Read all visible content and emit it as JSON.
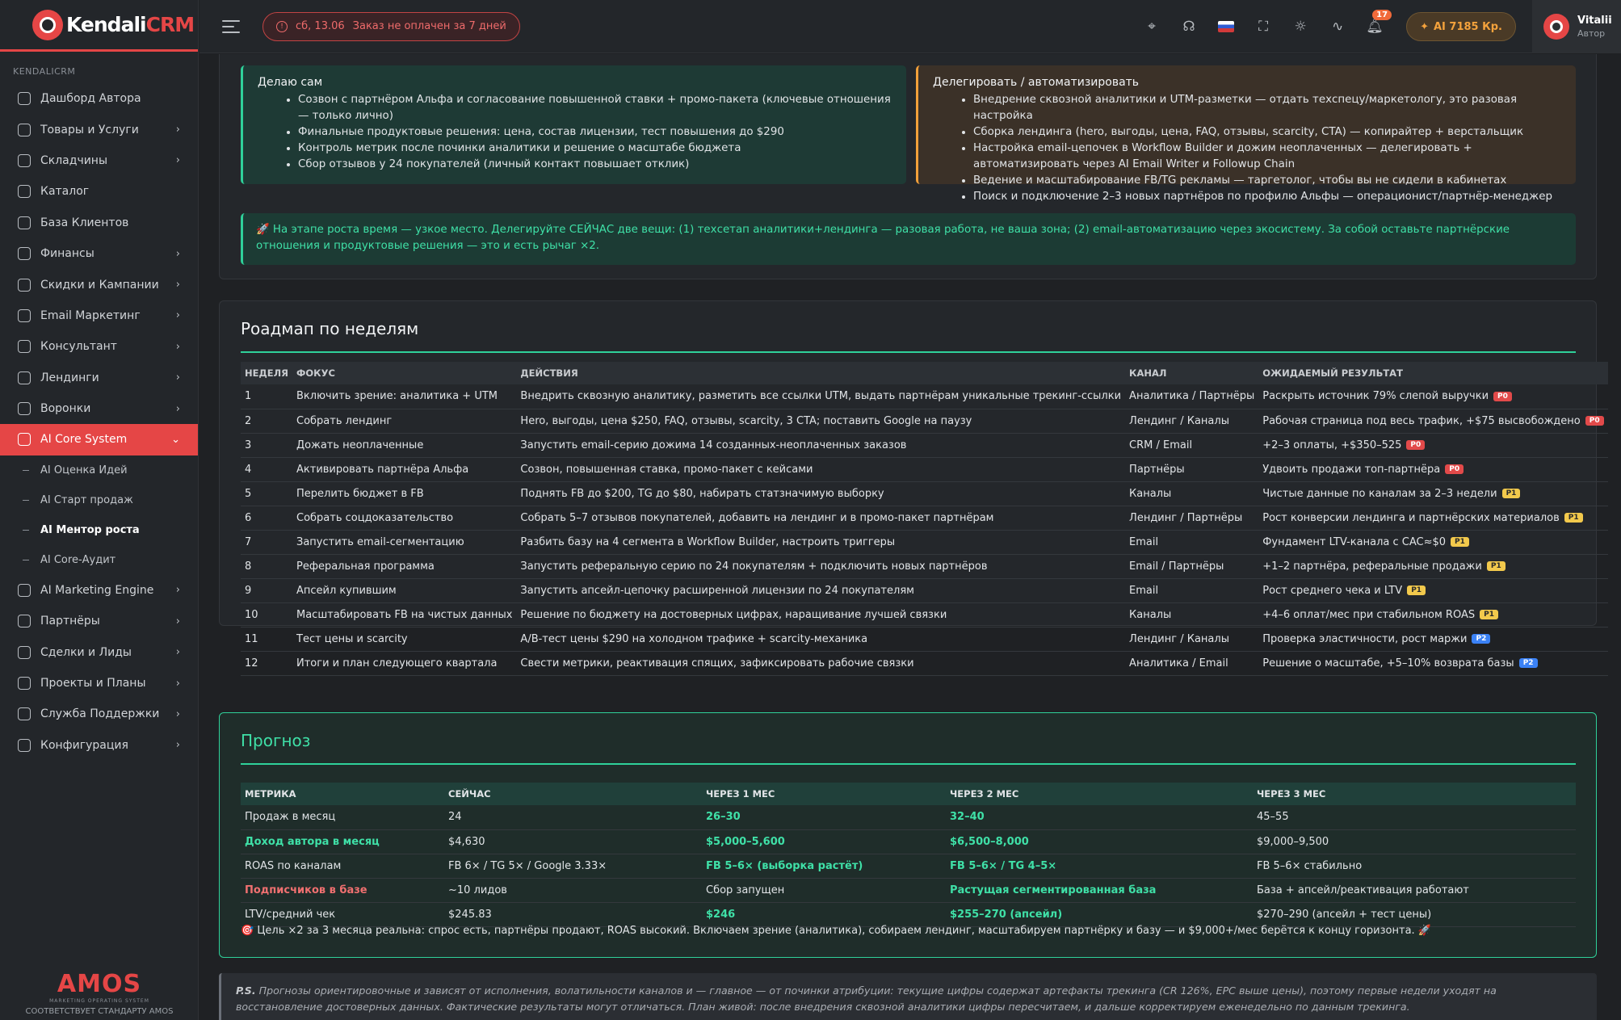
{
  "brand": {
    "name_a": "Kendali",
    "name_b": "CRM"
  },
  "sidebar": {
    "section_label": "KENDALICRM",
    "items": [
      {
        "label": "Дашборд Автора",
        "icon": "home-icon",
        "chevron": false
      },
      {
        "label": "Товары и Услуги",
        "icon": "box-icon",
        "chevron": true
      },
      {
        "label": "Складчины",
        "icon": "people-icon",
        "chevron": true
      },
      {
        "label": "Каталог",
        "icon": "store-icon",
        "chevron": false
      },
      {
        "label": "База Клиентов",
        "icon": "user-icon",
        "chevron": false
      },
      {
        "label": "Финансы",
        "icon": "wallet-icon",
        "chevron": true
      },
      {
        "label": "Скидки и Кампании",
        "icon": "tag-icon",
        "chevron": true
      },
      {
        "label": "Email Маркетинг",
        "icon": "mail-icon",
        "chevron": true
      },
      {
        "label": "Консультант",
        "icon": "headset-icon",
        "chevron": true
      },
      {
        "label": "Лендинги",
        "icon": "layout-icon",
        "chevron": true
      },
      {
        "label": "Воронки",
        "icon": "funnel-icon",
        "chevron": true
      },
      {
        "label": "AI Core System",
        "icon": "sparkle-icon",
        "chevron": true,
        "active": true
      }
    ],
    "sub_items": [
      "AI Оценка Идей",
      "AI Старт продаж",
      "AI Ментор роста",
      "AI Core-Аудит"
    ],
    "items_after": [
      {
        "label": "AI Marketing Engine",
        "icon": "rocket-icon"
      },
      {
        "label": "Партнёры",
        "icon": "partners-icon"
      },
      {
        "label": "Сделки и Лиды",
        "icon": "handshake-icon"
      },
      {
        "label": "Проекты и Планы",
        "icon": "projects-icon"
      },
      {
        "label": "Служба Поддержки",
        "icon": "support-icon"
      },
      {
        "label": "Конфигурация",
        "icon": "gear-icon"
      }
    ],
    "footer_logo": "AMOS",
    "footer_tagline": "MARKETING OPERATING SYSTEM",
    "footer_compliance": "СООТВЕТСТВУЕТ СТАНДАРТУ AMOS"
  },
  "topbar": {
    "alert_date": "сб, 13.06",
    "alert_text": "Заказ не оплачен за 7 дней",
    "notif_count": "17",
    "credits": "AI 7185 Кр.",
    "user_name": "Vitalii",
    "user_role": "Автор"
  },
  "self": {
    "title": "Делаю сам",
    "items": [
      "Созвон с партнёром Альфа и согласование повышенной ставки + промо-пакета (ключевые отношения — только лично)",
      "Финальные продуктовые решения: цена, состав лицензии, тест повышения до $290",
      "Контроль метрик после починки аналитики и решение о масштабе бюджета",
      "Сбор отзывов у 24 покупателей (личный контакт повышает отклик)"
    ]
  },
  "delegate": {
    "title": "Делегировать / автоматизировать",
    "items": [
      "Внедрение сквозной аналитики и UTM-разметки — отдать техспецу/маркетологу, это разовая настройка",
      "Сборка лендинга (hero, выгоды, цена, FAQ, отзывы, scarcity, CTA) — копирайтер + верстальщик",
      "Настройка email-цепочек в Workflow Builder и дожим неоплаченных — делегировать + автоматизировать через AI Email Writer и Followup Chain",
      "Ведение и масштабирование FB/TG рекламы — таргетолог, чтобы вы не сидели в кабинетах",
      "Поиск и подключение 2–3 новых партнёров по профилю Альфы — операционист/партнёр-менеджер"
    ]
  },
  "tip": "🚀 На этапе роста время — узкое место. Делегируйте СЕЙЧАС две вещи: (1) техсетап аналитики+лендинга — разовая работа, не ваша зона; (2) email-автоматизацию через экосистему. За собой оставьте партнёрские отношения и продуктовые решения — это и есть рычаг ×2.",
  "roadmap": {
    "title": "Роадмап по неделям",
    "headers": [
      "НЕДЕЛЯ",
      "ФОКУС",
      "ДЕЙСТВИЯ",
      "КАНАЛ",
      "ОЖИДАЕМЫЙ РЕЗУЛЬТАТ"
    ],
    "rows": [
      [
        "1",
        "Включить зрение: аналитика + UTM",
        "Внедрить сквозную аналитику, разметить все ссылки UTM, выдать партнёрам уникальные трекинг-ссылки",
        "Аналитика / Партнёры",
        "Раскрыть источник 79% слепой выручки",
        "P0"
      ],
      [
        "2",
        "Собрать лендинг",
        "Hero, выгоды, цена $250, FAQ, отзывы, scarcity, 3 CTA; поставить Google на паузу",
        "Лендинг / Каналы",
        "Рабочая страница под весь трафик, +$75 высвобождено",
        "P0"
      ],
      [
        "3",
        "Дожать неоплаченные",
        "Запустить email-серию дожима 14 созданных-неоплаченных заказов",
        "CRM / Email",
        "+2–3 оплаты, +$350–525",
        "P0"
      ],
      [
        "4",
        "Активировать партнёра Альфа",
        "Созвон, повышенная ставка, промо-пакет с кейсами",
        "Партнёры",
        "Удвоить продажи топ-партнёра",
        "P0"
      ],
      [
        "5",
        "Перелить бюджет в FB",
        "Поднять FB до $200, TG до $80, набирать статзначимую выборку",
        "Каналы",
        "Чистые данные по каналам за 2–3 недели",
        "P1"
      ],
      [
        "6",
        "Собрать соцдоказательство",
        "Собрать 5–7 отзывов покупателей, добавить на лендинг и в промо-пакет партнёрам",
        "Лендинг / Партнёры",
        "Рост конверсии лендинга и партнёрских материалов",
        "P1"
      ],
      [
        "7",
        "Запустить email-сегментацию",
        "Разбить базу на 4 сегмента в Workflow Builder, настроить триггеры",
        "Email",
        "Фундамент LTV-канала с CAC≈$0",
        "P1"
      ],
      [
        "8",
        "Реферальная программа",
        "Запустить реферальную серию по 24 покупателям + подключить новых партнёров",
        "Email / Партнёры",
        "+1–2 партнёра, реферальные продажи",
        "P1"
      ],
      [
        "9",
        "Апсейл купившим",
        "Запустить апсейл-цепочку расширенной лицензии по 24 покупателям",
        "Email",
        "Рост среднего чека и LTV",
        "P1"
      ],
      [
        "10",
        "Масштабировать FB на чистых данных",
        "Решение по бюджету на достоверных цифрах, наращивание лучшей связки",
        "Каналы",
        "+4–6 оплат/мес при стабильном ROAS",
        "P1"
      ],
      [
        "11",
        "Тест цены и scarcity",
        "A/B-тест цены $290 на холодном трафике + scarcity-механика",
        "Лендинг / Каналы",
        "Проверка эластичности, рост маржи",
        "P2"
      ],
      [
        "12",
        "Итоги и план следующего квартала",
        "Свести метрики, реактивация спящих, зафиксировать рабочие связки",
        "Аналитика / Email",
        "Решение о масштабе, +5–10% возврата базы",
        "P2"
      ]
    ]
  },
  "forecast": {
    "title": "Прогноз",
    "headers": [
      "МЕТРИКА",
      "СЕЙЧАС",
      "ЧЕРЕЗ 1 МЕС",
      "ЧЕРЕЗ 2 МЕС",
      "ЧЕРЕЗ 3 МЕС"
    ],
    "rows": [
      {
        "cells": [
          "Продаж в месяц",
          "24",
          "26–30",
          "32–40",
          "45–55"
        ],
        "styles": [
          "",
          "",
          "g",
          "g",
          ""
        ]
      },
      {
        "cells": [
          "Доход автора в месяц",
          "$4,630",
          "$5,000–5,600",
          "$6,500–8,000",
          "$9,000–9,500"
        ],
        "styles": [
          "g",
          "",
          "g",
          "g",
          ""
        ]
      },
      {
        "cells": [
          "ROAS по каналам",
          "FB 6× / TG 5× / Google 3.33×",
          "FB 5–6× (выборка растёт)",
          "FB 5–6× / TG 4–5×",
          "FB 5–6× стабильно"
        ],
        "styles": [
          "",
          "",
          "g",
          "g",
          ""
        ]
      },
      {
        "cells": [
          "Подписчиков в базе",
          "~10 лидов",
          "Сбор запущен",
          "Растущая сегментированная база",
          "База + апсейл/реактивация работают"
        ],
        "styles": [
          "r",
          "",
          "",
          "g",
          ""
        ]
      },
      {
        "cells": [
          "LTV/средний чек",
          "$245.83",
          "$246",
          "$255–270 (апсейл)",
          "$270–290 (апсейл + тест цены)"
        ],
        "styles": [
          "",
          "",
          "g",
          "g",
          ""
        ]
      }
    ],
    "note": "🎯 Цель ×2 за 3 месяца реальна: спрос есть, партнёры продают, ROAS высокий. Включаем зрение (аналитика), собираем лендинг, масштабируем партнёрку и базу — и $9,000+/мес берётся к концу горизонта. 🚀"
  },
  "ps": {
    "label": "P.S.",
    "text": "Прогнозы ориентировочные и зависят от исполнения, волатильности каналов и — главное — от починки атрибуции: текущие цифры содержат артефакты трекинга (CR 126%, EPC выше цены), поэтому первые недели уходят на восстановление достоверных данных. Фактические результаты могут отличаться. План живой: после внедрения сквозной аналитики цифры пересчитаем, и дальше корректируем еженедельно по данным трекинга."
  },
  "colors": {
    "accent": "#e54646",
    "green": "#2fd19a",
    "orange": "#f2a03a"
  }
}
